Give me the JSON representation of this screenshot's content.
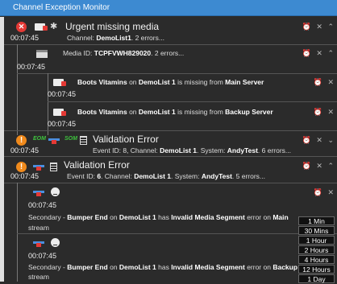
{
  "window": {
    "title": "Channel Exception Monitor"
  },
  "rows": {
    "r1": {
      "time": "00:07:45",
      "heading": "Urgent missing media",
      "line": [
        "Channel: ",
        "DemoList1",
        ". 2 errors..."
      ]
    },
    "r2": {
      "time": "00:07:45",
      "line": [
        "Media ID: ",
        "TCPFVWH829020",
        ". 2 errors..."
      ]
    },
    "r3": {
      "time": "00:07:45",
      "line": [
        "Boots Vitamins",
        " on ",
        "DemoList 1",
        " is missing from ",
        "Main Server"
      ]
    },
    "r4": {
      "time": "00:07:45",
      "line": [
        "Boots Vitamins",
        " on ",
        "DemoList 1",
        " is missing from ",
        "Backup Server"
      ]
    },
    "r5": {
      "time": "00:07:45",
      "heading": "Validation Error",
      "badge": "EOM",
      "badge2": "SOM",
      "line": [
        "Event ID: 8, Channel: ",
        "DemoList 1",
        ". System: ",
        "AndyTest",
        ". 6 errors..."
      ]
    },
    "r6": {
      "time": "00:07:45",
      "heading": "Validation Error",
      "line": [
        "Event ID: ",
        "6",
        ". Channel: ",
        "DemoList 1",
        ". System: ",
        "AndyTest",
        ". 5 errors..."
      ]
    },
    "r7": {
      "time": "00:07:45",
      "line": [
        "Secondary - ",
        "Bumper End",
        " on ",
        "DemoList 1",
        " has ",
        "Invalid Media Segment",
        " error on ",
        "Main"
      ],
      "wrap": "stream"
    },
    "r8": {
      "time": "00:07:45",
      "line": [
        "Secondary - ",
        "Bumper End",
        " on ",
        "DemoList 1",
        " has ",
        "Invalid Media Segment",
        " error on ",
        "Backup"
      ],
      "wrap": "stream"
    }
  },
  "snooze_menu": [
    "1 Min",
    "30 Mins",
    "1 Hour",
    "2 Hours",
    "4 Hours",
    "12 Hours",
    "1 Day"
  ],
  "colors": {
    "titlebar": "#3d8ad1",
    "error": "#e53935",
    "warning": "#f08a1c",
    "eom": "#3ec33e"
  }
}
